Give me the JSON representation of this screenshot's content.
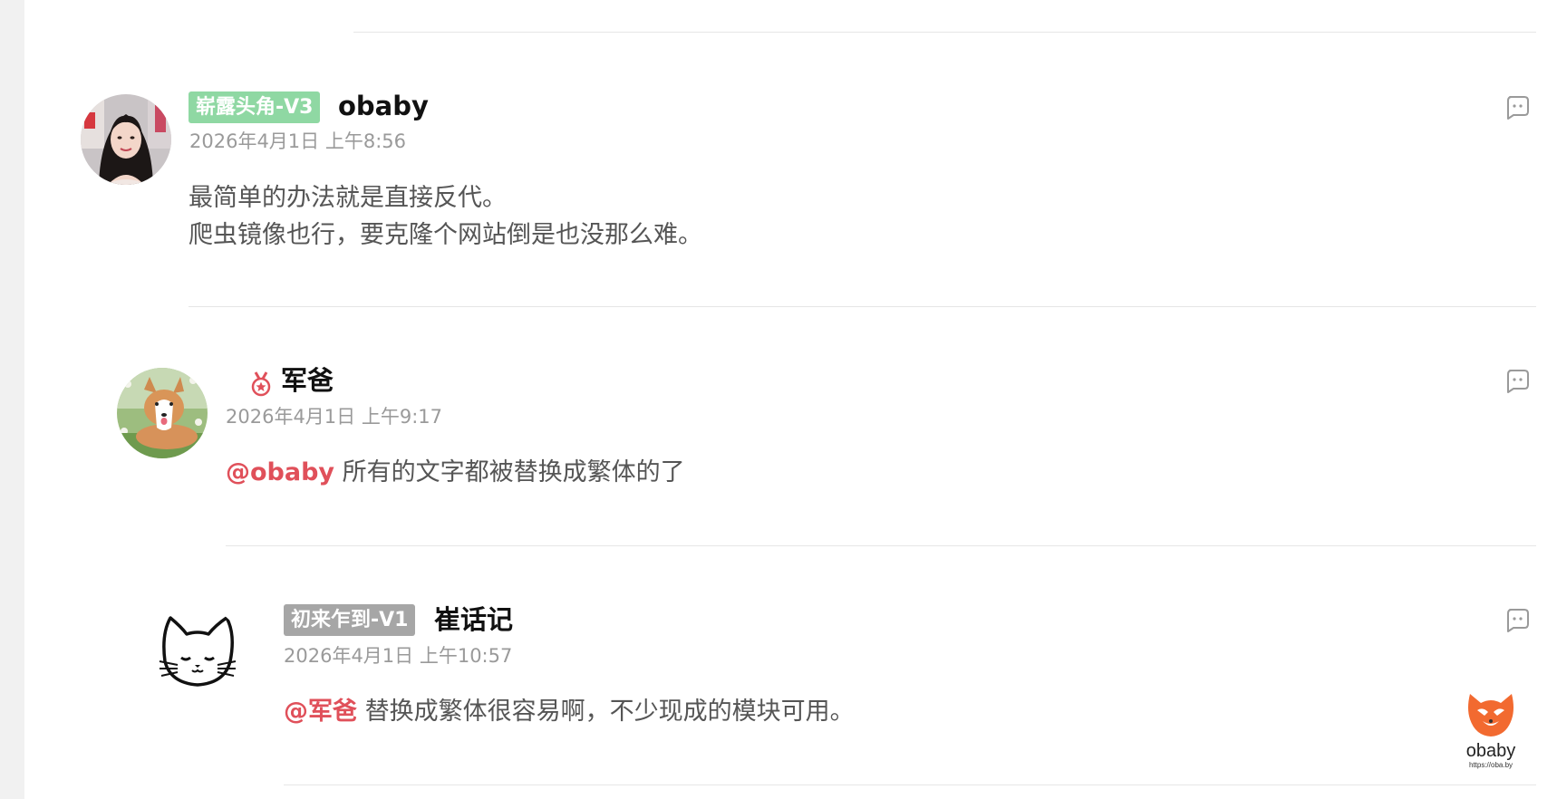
{
  "comments": [
    {
      "badge": "崭露头角-V3",
      "badge_color": "#8fd8a3",
      "author": "obaby",
      "date": "2026年4月1日 上午8:56",
      "lines": [
        "最简单的办法就是直接反代。",
        "爬虫镜像也行，要克隆个网站倒是也没那么难。"
      ],
      "avatar": "girl-portrait"
    },
    {
      "medal_icon": "medal-icon",
      "author": "军爸",
      "date": "2026年4月1日 上午9:17",
      "mention": "@obaby",
      "text": " 所有的文字都被替换成繁体的了",
      "avatar": "corgi-dog-photo"
    },
    {
      "badge": "初来乍到-V1",
      "badge_color": "#a6a6a6",
      "author": "崔话记",
      "date": "2026年4月1日 上午10:57",
      "mention": "@军爸",
      "text": " 替换成繁体很容易啊，不少现成的模块可用。",
      "avatar": "cat-line-drawing"
    }
  ],
  "mention_color": "#e0505a",
  "brand": {
    "name": "obaby",
    "url": "https://oba.by",
    "color": "#f26a30"
  }
}
